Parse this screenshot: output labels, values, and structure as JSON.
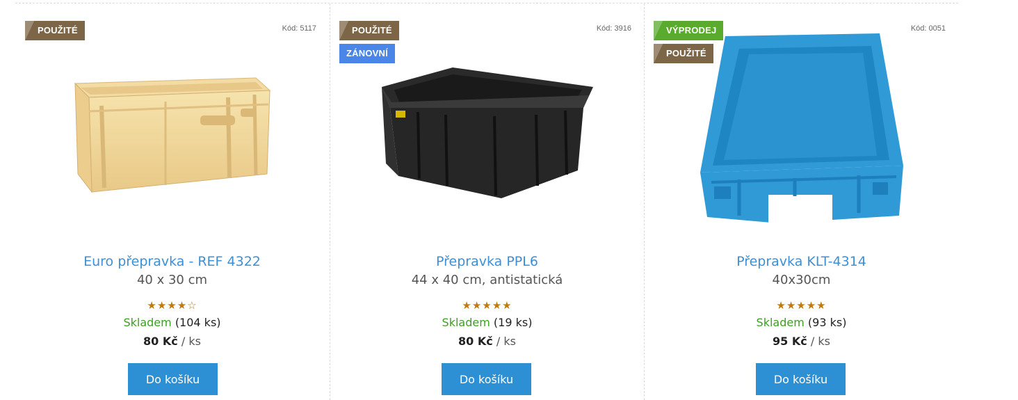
{
  "products": [
    {
      "flags": [
        "POUŽITÉ"
      ],
      "code": "Kód: 5117",
      "name": "Euro přepravka - REF 4322",
      "desc": "40 x 30 cm",
      "rating": 4,
      "stars": "★★★★☆",
      "availability": "Skladem",
      "stock_qty": "(104 ks)",
      "price": "80 Kč",
      "unit": "/ ks",
      "button": "Do košíku",
      "image": "beige-euro-crate"
    },
    {
      "flags": [
        "POUŽITÉ",
        "ZÁNOVNÍ"
      ],
      "code": "Kód: 3916",
      "name": "Přepravka PPL6",
      "desc": "44 x 40 cm, antistatická",
      "rating": 4.5,
      "stars": "★★★★★",
      "availability": "Skladem",
      "stock_qty": "(19 ks)",
      "price": "80 Kč",
      "unit": "/ ks",
      "button": "Do košíku",
      "image": "black-antistatic-crate"
    },
    {
      "flags": [
        "VÝPRODEJ",
        "POUŽITÉ"
      ],
      "code": "Kód: 0051",
      "name": "Přepravka KLT-4314",
      "desc": "40x30cm",
      "rating": 5,
      "stars": "★★★★★",
      "availability": "Skladem",
      "stock_qty": "(93 ks)",
      "price": "95 Kč",
      "unit": "/ ks",
      "button": "Do košíku",
      "image": "blue-klt-crate"
    }
  ],
  "colors": {
    "link": "#3d8fd6",
    "button": "#2e90d4",
    "in_stock": "#39a31e",
    "star": "#c07a09",
    "flag_used": "#7d6548",
    "flag_renewed": "#4a86e8",
    "flag_sale": "#5aaa2e"
  }
}
